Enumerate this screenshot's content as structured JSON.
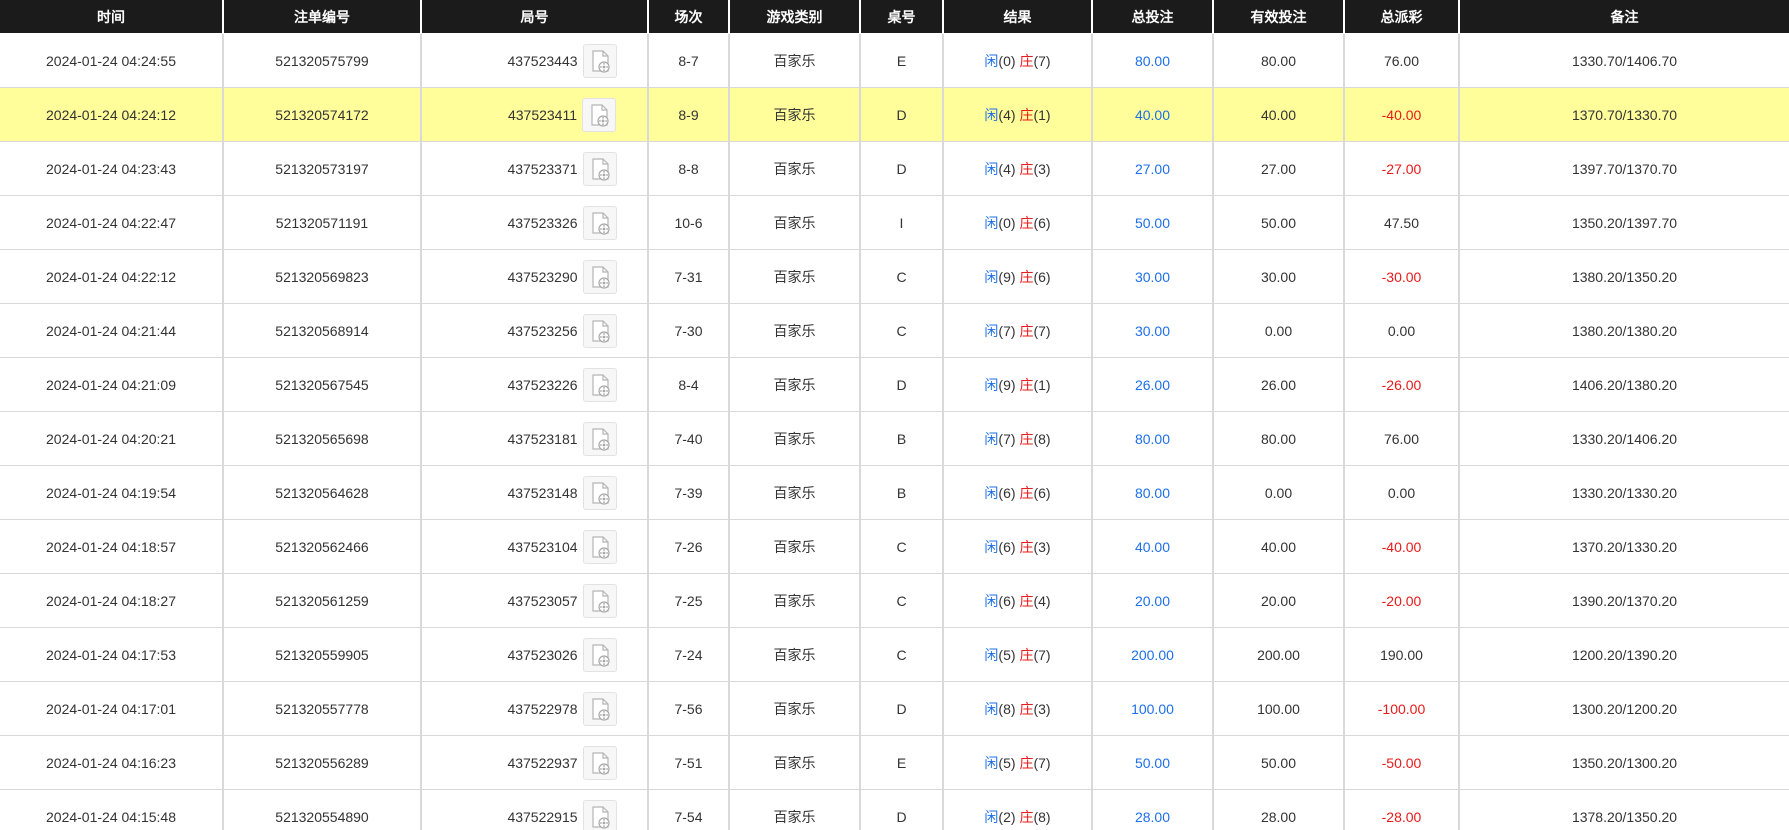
{
  "headers": {
    "time": "时间",
    "order_no": "注单编号",
    "round_no": "局号",
    "shoe": "场次",
    "game_type": "游戏类别",
    "table_no": "桌号",
    "result": "结果",
    "total_bet": "总投注",
    "valid_bet": "有效投注",
    "payout": "总派彩",
    "note": "备注"
  },
  "result_labels": {
    "player": "闲",
    "banker": "庄"
  },
  "colors": {
    "header_bg": "#1b1b1b",
    "highlight_row": "#fffe9a",
    "blue": "#1d6fe8",
    "red": "#e81a1a"
  },
  "row_icon": "replay-document-icon",
  "rows": [
    {
      "time": "2024-01-24 04:24:55",
      "order_no": "521320575799",
      "round_no": "437523443",
      "shoe": "8-7",
      "game_type": "百家乐",
      "table_no": "E",
      "player": "(0)",
      "banker": "(7)",
      "total_bet": "80.00",
      "valid_bet": "80.00",
      "payout": "76.00",
      "payout_negative": false,
      "note": "1330.70/1406.70",
      "highlighted": false
    },
    {
      "time": "2024-01-24 04:24:12",
      "order_no": "521320574172",
      "round_no": "437523411",
      "shoe": "8-9",
      "game_type": "百家乐",
      "table_no": "D",
      "player": "(4)",
      "banker": "(1)",
      "total_bet": "40.00",
      "valid_bet": "40.00",
      "payout": "-40.00",
      "payout_negative": true,
      "note": "1370.70/1330.70",
      "highlighted": true
    },
    {
      "time": "2024-01-24 04:23:43",
      "order_no": "521320573197",
      "round_no": "437523371",
      "shoe": "8-8",
      "game_type": "百家乐",
      "table_no": "D",
      "player": "(4)",
      "banker": "(3)",
      "total_bet": "27.00",
      "valid_bet": "27.00",
      "payout": "-27.00",
      "payout_negative": true,
      "note": "1397.70/1370.70",
      "highlighted": false
    },
    {
      "time": "2024-01-24 04:22:47",
      "order_no": "521320571191",
      "round_no": "437523326",
      "shoe": "10-6",
      "game_type": "百家乐",
      "table_no": "I",
      "player": "(0)",
      "banker": "(6)",
      "total_bet": "50.00",
      "valid_bet": "50.00",
      "payout": "47.50",
      "payout_negative": false,
      "note": "1350.20/1397.70",
      "highlighted": false
    },
    {
      "time": "2024-01-24 04:22:12",
      "order_no": "521320569823",
      "round_no": "437523290",
      "shoe": "7-31",
      "game_type": "百家乐",
      "table_no": "C",
      "player": "(9)",
      "banker": "(6)",
      "total_bet": "30.00",
      "valid_bet": "30.00",
      "payout": "-30.00",
      "payout_negative": true,
      "note": "1380.20/1350.20",
      "highlighted": false
    },
    {
      "time": "2024-01-24 04:21:44",
      "order_no": "521320568914",
      "round_no": "437523256",
      "shoe": "7-30",
      "game_type": "百家乐",
      "table_no": "C",
      "player": "(7)",
      "banker": "(7)",
      "total_bet": "30.00",
      "valid_bet": "0.00",
      "payout": "0.00",
      "payout_negative": false,
      "note": "1380.20/1380.20",
      "highlighted": false
    },
    {
      "time": "2024-01-24 04:21:09",
      "order_no": "521320567545",
      "round_no": "437523226",
      "shoe": "8-4",
      "game_type": "百家乐",
      "table_no": "D",
      "player": "(9)",
      "banker": "(1)",
      "total_bet": "26.00",
      "valid_bet": "26.00",
      "payout": "-26.00",
      "payout_negative": true,
      "note": "1406.20/1380.20",
      "highlighted": false
    },
    {
      "time": "2024-01-24 04:20:21",
      "order_no": "521320565698",
      "round_no": "437523181",
      "shoe": "7-40",
      "game_type": "百家乐",
      "table_no": "B",
      "player": "(7)",
      "banker": "(8)",
      "total_bet": "80.00",
      "valid_bet": "80.00",
      "payout": "76.00",
      "payout_negative": false,
      "note": "1330.20/1406.20",
      "highlighted": false
    },
    {
      "time": "2024-01-24 04:19:54",
      "order_no": "521320564628",
      "round_no": "437523148",
      "shoe": "7-39",
      "game_type": "百家乐",
      "table_no": "B",
      "player": "(6)",
      "banker": "(6)",
      "total_bet": "80.00",
      "valid_bet": "0.00",
      "payout": "0.00",
      "payout_negative": false,
      "note": "1330.20/1330.20",
      "highlighted": false
    },
    {
      "time": "2024-01-24 04:18:57",
      "order_no": "521320562466",
      "round_no": "437523104",
      "shoe": "7-26",
      "game_type": "百家乐",
      "table_no": "C",
      "player": "(6)",
      "banker": "(3)",
      "total_bet": "40.00",
      "valid_bet": "40.00",
      "payout": "-40.00",
      "payout_negative": true,
      "note": "1370.20/1330.20",
      "highlighted": false
    },
    {
      "time": "2024-01-24 04:18:27",
      "order_no": "521320561259",
      "round_no": "437523057",
      "shoe": "7-25",
      "game_type": "百家乐",
      "table_no": "C",
      "player": "(6)",
      "banker": "(4)",
      "total_bet": "20.00",
      "valid_bet": "20.00",
      "payout": "-20.00",
      "payout_negative": true,
      "note": "1390.20/1370.20",
      "highlighted": false
    },
    {
      "time": "2024-01-24 04:17:53",
      "order_no": "521320559905",
      "round_no": "437523026",
      "shoe": "7-24",
      "game_type": "百家乐",
      "table_no": "C",
      "player": "(5)",
      "banker": "(7)",
      "total_bet": "200.00",
      "valid_bet": "200.00",
      "payout": "190.00",
      "payout_negative": false,
      "note": "1200.20/1390.20",
      "highlighted": false
    },
    {
      "time": "2024-01-24 04:17:01",
      "order_no": "521320557778",
      "round_no": "437522978",
      "shoe": "7-56",
      "game_type": "百家乐",
      "table_no": "D",
      "player": "(8)",
      "banker": "(3)",
      "total_bet": "100.00",
      "valid_bet": "100.00",
      "payout": "-100.00",
      "payout_negative": true,
      "note": "1300.20/1200.20",
      "highlighted": false
    },
    {
      "time": "2024-01-24 04:16:23",
      "order_no": "521320556289",
      "round_no": "437522937",
      "shoe": "7-51",
      "game_type": "百家乐",
      "table_no": "E",
      "player": "(5)",
      "banker": "(7)",
      "total_bet": "50.00",
      "valid_bet": "50.00",
      "payout": "-50.00",
      "payout_negative": true,
      "note": "1350.20/1300.20",
      "highlighted": false
    },
    {
      "time": "2024-01-24 04:15:48",
      "order_no": "521320554890",
      "round_no": "437522915",
      "shoe": "7-54",
      "game_type": "百家乐",
      "table_no": "D",
      "player": "(2)",
      "banker": "(8)",
      "total_bet": "28.00",
      "valid_bet": "28.00",
      "payout": "-28.00",
      "payout_negative": true,
      "note": "1378.20/1350.20",
      "highlighted": false
    }
  ]
}
